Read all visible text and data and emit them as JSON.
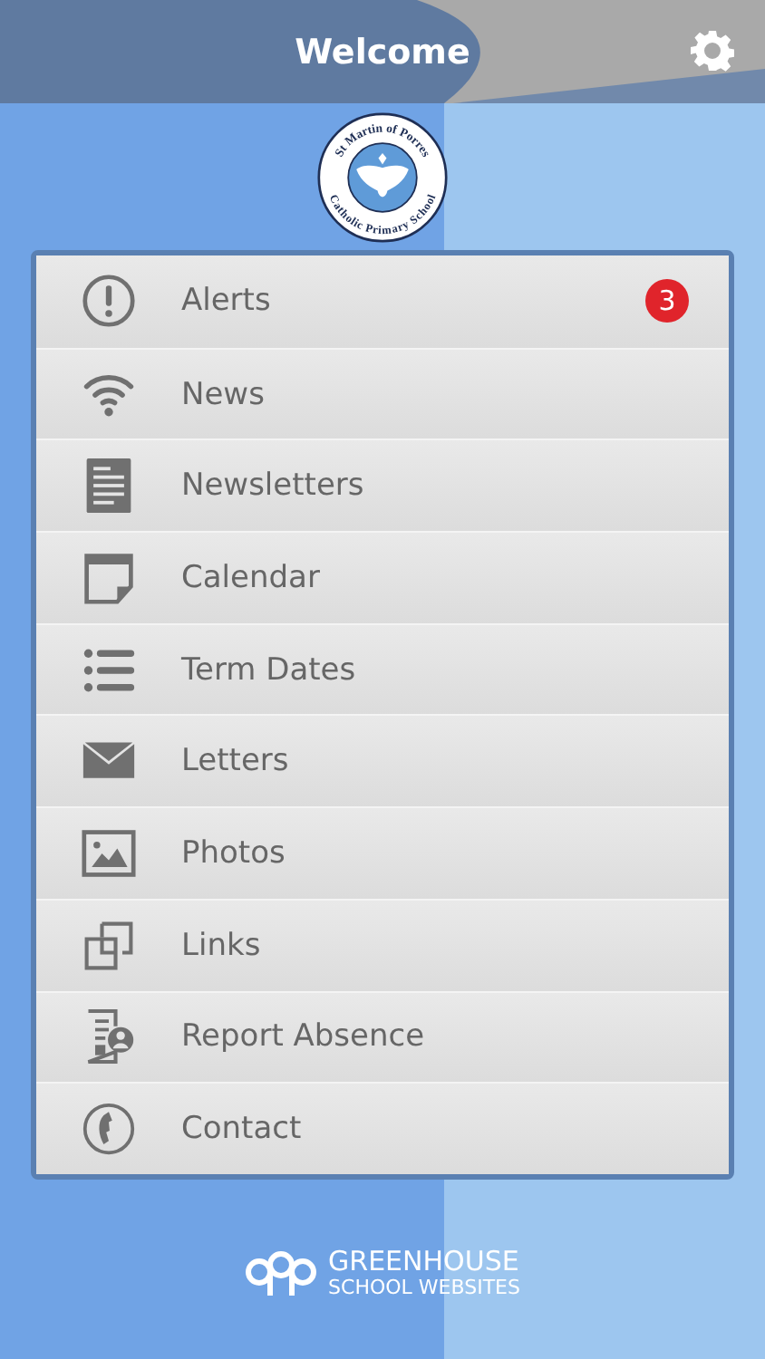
{
  "header": {
    "title": "Welcome"
  },
  "logo": {
    "top_text": "St Martin of Porres",
    "bottom_text": "Catholic Primary School"
  },
  "menu": [
    {
      "label": "Alerts",
      "kind": "alert",
      "badge": "3"
    },
    {
      "label": "News",
      "kind": "wifi"
    },
    {
      "label": "Newsletters",
      "kind": "document"
    },
    {
      "label": "Calendar",
      "kind": "calendar"
    },
    {
      "label": "Term Dates",
      "kind": "list"
    },
    {
      "label": "Letters",
      "kind": "envelope"
    },
    {
      "label": "Photos",
      "kind": "image"
    },
    {
      "label": "Links",
      "kind": "links"
    },
    {
      "label": "Report Absence",
      "kind": "report"
    },
    {
      "label": "Contact",
      "kind": "phone"
    }
  ],
  "footer": {
    "line_1": "GREENHOUSE",
    "line_2": "SCHOOL WEBSITES"
  }
}
